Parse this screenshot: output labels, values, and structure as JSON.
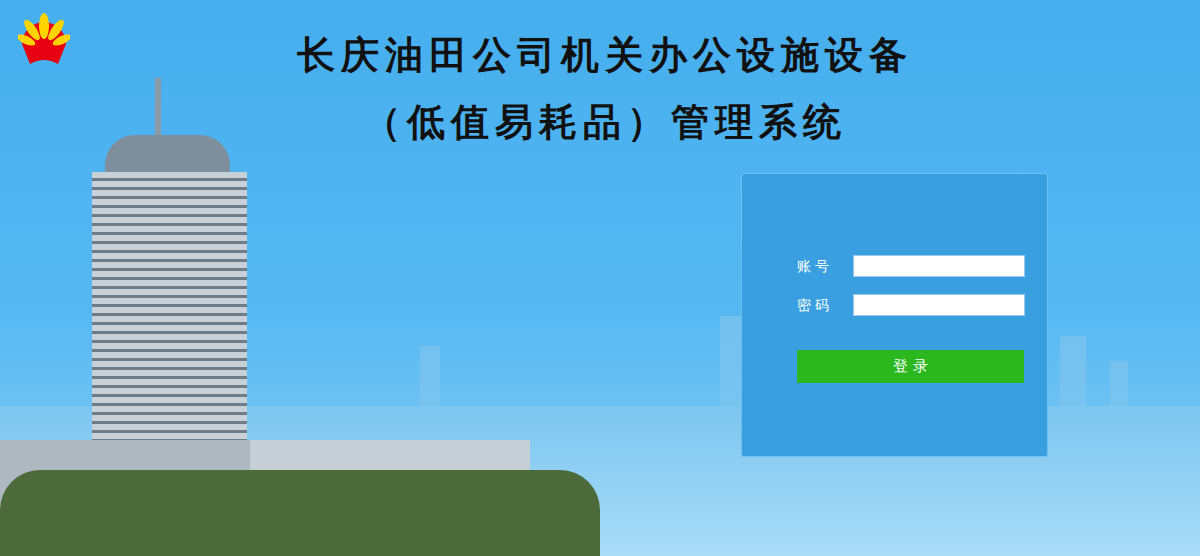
{
  "title": {
    "lines": [
      "长庆油田公司机关办公设施设备",
      "（低值易耗品）管理系统"
    ]
  },
  "login": {
    "fields": [
      {
        "label": "账 号"
      },
      {
        "label": "密 码"
      }
    ],
    "button": "登 录"
  }
}
